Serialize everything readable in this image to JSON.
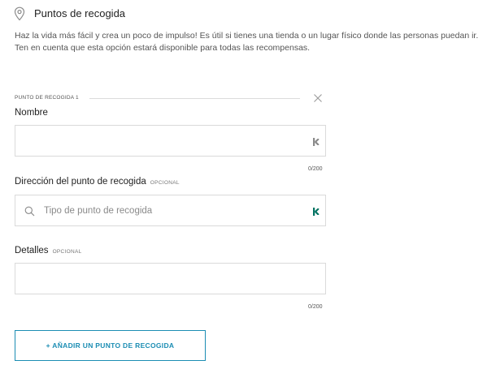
{
  "header": {
    "title": "Puntos de recogida",
    "description_line1": "Haz la vida más fácil y crea un poco de impulso! Es útil si tienes una tienda o un lugar físico donde las personas puedan ir.",
    "description_line2": "Ten en cuenta que esta opción estará disponible para todas las recompensas."
  },
  "pickup_point": {
    "section_label": "PUNTO DE RECOGIDA 1",
    "fields": {
      "name": {
        "label": "Nombre",
        "value": "",
        "counter": "0/200"
      },
      "address": {
        "label": "Dirección del punto de recogida",
        "optional": "OPCIONAL",
        "placeholder": "Tipo de punto de recogida",
        "value": ""
      },
      "details": {
        "label": "Detalles",
        "optional": "OPCIONAL",
        "value": "",
        "counter": "0/200"
      }
    }
  },
  "actions": {
    "add_label": "+ AÑADIR UN PUNTO DE RECOGIDA"
  },
  "icons": {
    "header": "location-pin-icon",
    "close": "close-icon",
    "search": "search-icon",
    "kick_gray": "kickstarter-k-icon",
    "kick_green": "kickstarter-k-icon"
  },
  "colors": {
    "accent": "#1b8db3",
    "kick_green": "#037362",
    "kick_gray": "#8a8a8a",
    "border": "#dadada"
  }
}
